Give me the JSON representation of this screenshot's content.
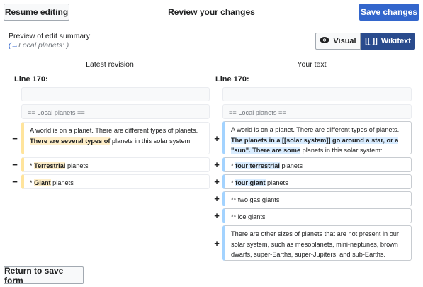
{
  "toolbar": {
    "resume_label": "Resume editing",
    "title": "Review your changes",
    "save_label": "Save changes"
  },
  "summary": {
    "label": "Preview of edit summary:",
    "arrow": "(→",
    "section": "Local planets: )"
  },
  "view_toggle": {
    "visual_label": "Visual",
    "wikitext_label": "Wikitext",
    "wikitext_glyph": "[[ ]]",
    "selected": "Wikitext"
  },
  "diff": {
    "left_header": "Latest revision",
    "right_header": "Your text",
    "left_line": "Line 170:",
    "right_line": "Line 170:",
    "context_heading": "== Local planets ==",
    "removed": {
      "para_pre": "A world is on a planet. There are different types of planets. ",
      "para_hl": "There are several types of",
      "para_post": " planets in this solar system:",
      "item1_pre": "* ",
      "item1_hl": "Terrestrial",
      "item1_post": " planets",
      "item2_pre": "* ",
      "item2_hl": "Giant",
      "item2_post": " planets"
    },
    "added": {
      "para_pre": "A world is on a planet. There are different types of planets. ",
      "para_hl": "The planets in a [[solar system]] go around a star, or a \"sun\". There are some",
      "para_post": " planets in this solar system:",
      "item1_pre": "* ",
      "item1_hl": "four terrestrial",
      "item1_post": " planets",
      "item2_pre": "* ",
      "item2_hl": "four giant",
      "item2_post": " planets",
      "item3": "** two gas giants",
      "item4": "** ice giants",
      "para2": "There are other sizes of planets that are not present in our solar system, such as mesoplanets, mini-neptunes, brown dwarfs, super-Earths, super-Jupiters, and sub-Earths."
    },
    "minus": "−",
    "plus": "+"
  },
  "footer": {
    "return_label": "Return to save form"
  }
}
